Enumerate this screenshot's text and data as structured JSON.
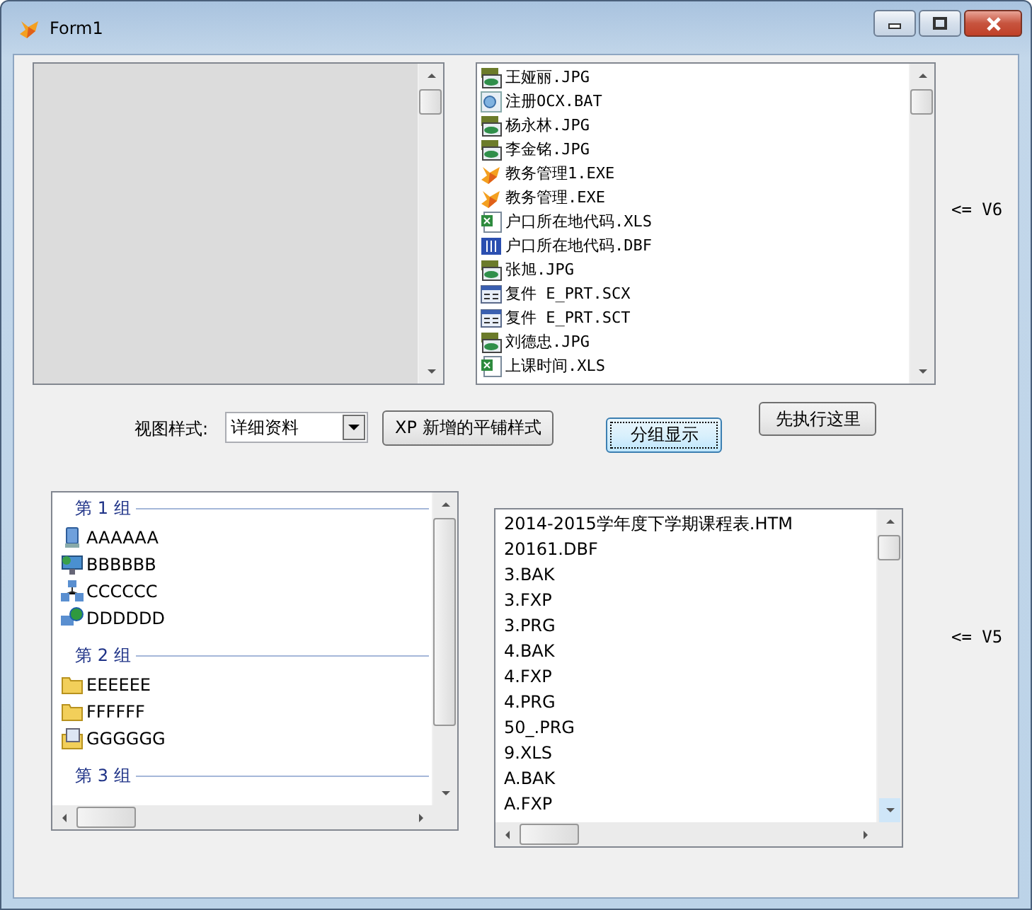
{
  "window": {
    "title": "Form1"
  },
  "file_list": {
    "items": [
      {
        "name": "王娅丽.JPG",
        "kind": "jpg"
      },
      {
        "name": "注册OCX.BAT",
        "kind": "bat"
      },
      {
        "name": "杨永林.JPG",
        "kind": "jpg"
      },
      {
        "name": "李金铭.JPG",
        "kind": "jpg"
      },
      {
        "name": "教务管理1.EXE",
        "kind": "exe"
      },
      {
        "name": "教务管理.EXE",
        "kind": "exe"
      },
      {
        "name": "户口所在地代码.XLS",
        "kind": "xls"
      },
      {
        "name": "户口所在地代码.DBF",
        "kind": "dbf"
      },
      {
        "name": "张旭.JPG",
        "kind": "jpg"
      },
      {
        "name": "复件 E_PRT.SCX",
        "kind": "form"
      },
      {
        "name": "复件 E_PRT.SCT",
        "kind": "form"
      },
      {
        "name": "刘德忠.JPG",
        "kind": "jpg"
      },
      {
        "name": "上课时间.XLS",
        "kind": "xls"
      }
    ],
    "label": "<= V6"
  },
  "view_style": {
    "label": "视图样式:",
    "value": "详细资料"
  },
  "tile_button": {
    "label": "XP 新增的平铺样式",
    "focused": false
  },
  "group_button": {
    "label": "分组显示",
    "focused": true
  },
  "run_button": {
    "label": "先执行这里",
    "focused": false
  },
  "group_list": {
    "groups": [
      {
        "header": "第 1 组",
        "items": [
          {
            "name": "AAAAAA",
            "kind": "computer"
          },
          {
            "name": "BBBBBB",
            "kind": "monitor"
          },
          {
            "name": "CCCCCC",
            "kind": "network"
          },
          {
            "name": "DDDDDD",
            "kind": "globe"
          }
        ]
      },
      {
        "header": "第 2 组",
        "items": [
          {
            "name": "EEEEEE",
            "kind": "folder"
          },
          {
            "name": "FFFFFF",
            "kind": "folder"
          },
          {
            "name": "GGGGGG",
            "kind": "document-folder"
          }
        ]
      },
      {
        "header": "第 3 组"
      }
    ]
  },
  "dir_list": {
    "items": [
      "2014-2015学年度下学期课程表.HTM",
      "20161.DBF",
      "3.BAK",
      "3.FXP",
      "3.PRG",
      "4.BAK",
      "4.FXP",
      "4.PRG",
      "50_.PRG",
      "9.XLS",
      "A.BAK",
      "A.FXP"
    ],
    "label": "<= V5"
  }
}
